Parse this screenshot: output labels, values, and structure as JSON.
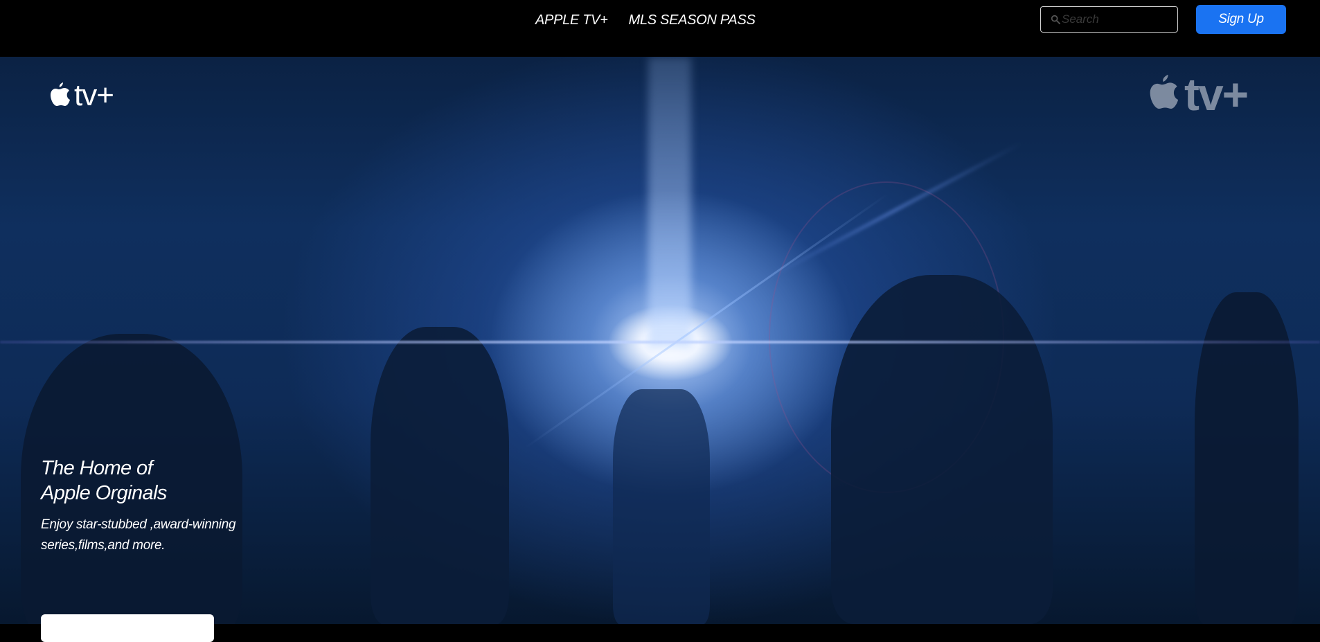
{
  "nav": {
    "links": [
      {
        "label": "APPLE TV+"
      },
      {
        "label": "MLS SEASON PASS"
      }
    ],
    "search": {
      "placeholder": "Search",
      "icon": "search-icon"
    },
    "signup_label": "Sign Up",
    "accent": "#1a73f2"
  },
  "hero": {
    "logo_left_text": "tv+",
    "logo_right_text": "tv+",
    "title_line1": "The Home of",
    "title_line2": "Apple Orginals",
    "subtitle_line1": "Enjoy star-stubbed ,award-winning",
    "subtitle_line2": "series,films,and more.",
    "cta_label": ""
  }
}
